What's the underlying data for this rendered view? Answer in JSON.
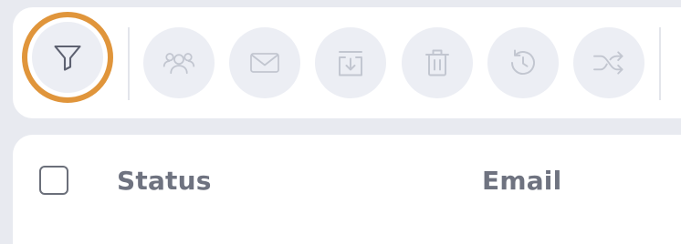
{
  "toolbar": {
    "actions": [
      {
        "id": "filter",
        "icon": "filter-icon",
        "state": "active"
      },
      {
        "id": "assign",
        "icon": "users-icon",
        "state": "disabled"
      },
      {
        "id": "email",
        "icon": "envelope-icon",
        "state": "disabled"
      },
      {
        "id": "download",
        "icon": "download-icon",
        "state": "disabled"
      },
      {
        "id": "delete",
        "icon": "trash-icon",
        "state": "disabled"
      },
      {
        "id": "history",
        "icon": "history-icon",
        "state": "disabled"
      },
      {
        "id": "shuffle",
        "icon": "shuffle-icon",
        "state": "disabled"
      }
    ],
    "highlight_color": "#e0953b"
  },
  "table": {
    "headers": {
      "status": "Status",
      "email": "Email"
    },
    "select_all_checked": false
  },
  "colors": {
    "background": "#e8eaf0",
    "card": "#ffffff",
    "button_bg": "#eceef4",
    "icon_active": "#5d6170",
    "icon_disabled": "#c2c6d0",
    "header_text": "#6f7380"
  }
}
